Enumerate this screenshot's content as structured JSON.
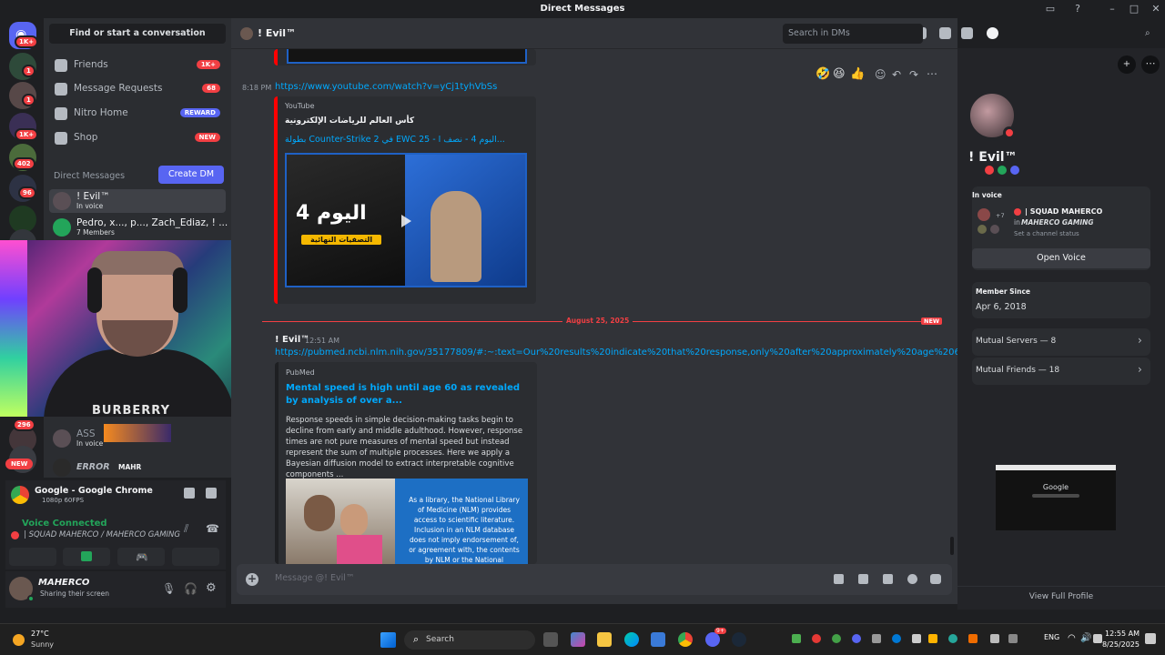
{
  "window": {
    "title": "Direct Messages"
  },
  "servers": {
    "home_badge": "1K+",
    "badges": [
      "1",
      "1",
      "1K+",
      "402",
      "96",
      "296"
    ],
    "new_label": "NEW"
  },
  "sidebar": {
    "search": "Find or start a conversation",
    "nav": [
      {
        "label": "Friends",
        "badge": "1K+"
      },
      {
        "label": "Message Requests",
        "badge": "68"
      },
      {
        "label": "Nitro Home",
        "badge": "REWARD"
      },
      {
        "label": "Shop",
        "badge": "NEW"
      }
    ],
    "section_title": "Direct Messages",
    "create_dm": "Create DM",
    "dms": [
      {
        "name": "! Evil™",
        "status": "In voice"
      },
      {
        "name": "Pedro, x..., p..., Zach_Ediaz, ! ...",
        "status": "7 Members"
      }
    ],
    "partial_dms": [
      {
        "name": "ASS",
        "status": "In voice"
      },
      {
        "name": "ERROR",
        "status": "MAHR"
      }
    ],
    "webcam_text": "BURBERRY"
  },
  "stream": {
    "app": "Google - Google Chrome",
    "quality": "1080p 60FPS"
  },
  "voice": {
    "status": "Voice Connected",
    "channel": "| SQUAD MAHERCO / MAHERCO GAMING"
  },
  "user": {
    "name": "MAHERCO",
    "status": "Sharing their screen"
  },
  "chat": {
    "recipient": "! Evil™",
    "search_placeholder": "Search in DMs",
    "msg1": {
      "time": "8:18 PM",
      "url": "https://www.youtube.com/watch?v=yCj1tyhVbSs",
      "provider": "YouTube",
      "embed_title": "كأس العالم للرياضات الإلكترونية",
      "embed_link": "بطولة Counter-Strike 2 في EWC 25 - اليوم  4 - نصف ا...",
      "thumb_big": "اليوم 4",
      "thumb_sub": "التصفيات النهائية"
    },
    "divider_date": "August 25, 2025",
    "divider_new": "NEW",
    "msg2": {
      "author": "! Evil™",
      "time": "12:51 AM",
      "url": "https://pubmed.ncbi.nlm.nih.gov/35177809/#:~:text=Our%20results%20indicate%20that%20response,only%20after%20approximately%20age%2060.",
      "provider": "PubMed",
      "embed_title": "Mental speed is high until age 60 as revealed by analysis of over a...",
      "embed_desc": "Response speeds in simple decision-making tasks begin to decline from early and middle adulthood. However, response times are not pure measures of mental speed but instead represent the sum of multiple processes. Here we apply a Bayesian diffusion model to extract interpretable cognitive components ...",
      "image_text": "As a library, the National Library of Medicine (NLM) provides access to scientific literature. Inclusion in an NLM database does not imply endorsement of, or agreement with, the contents by NLM or the National"
    },
    "input_placeholder": "Message @! Evil™"
  },
  "profile": {
    "name": "! Evil™",
    "in_voice_label": "In voice",
    "voice_channel": "| SQUAD MAHERCO",
    "voice_server_prefix": "in",
    "voice_server": "MAHERCO GAMING",
    "voice_count": "+7",
    "channel_status": "Set a channel status",
    "open_voice": "Open Voice",
    "member_since_label": "Member Since",
    "member_since": "Apr 6, 2018",
    "mutual_servers": "Mutual Servers — 8",
    "mutual_friends": "Mutual Friends — 18",
    "view_full": "View Full Profile",
    "preview_text": "Google"
  },
  "taskbar": {
    "temp": "27°C",
    "weather": "Sunny",
    "search": "Search",
    "lang": "ENG",
    "time": "12:55 AM",
    "date": "8/25/2025",
    "chat_badge": "9+"
  }
}
